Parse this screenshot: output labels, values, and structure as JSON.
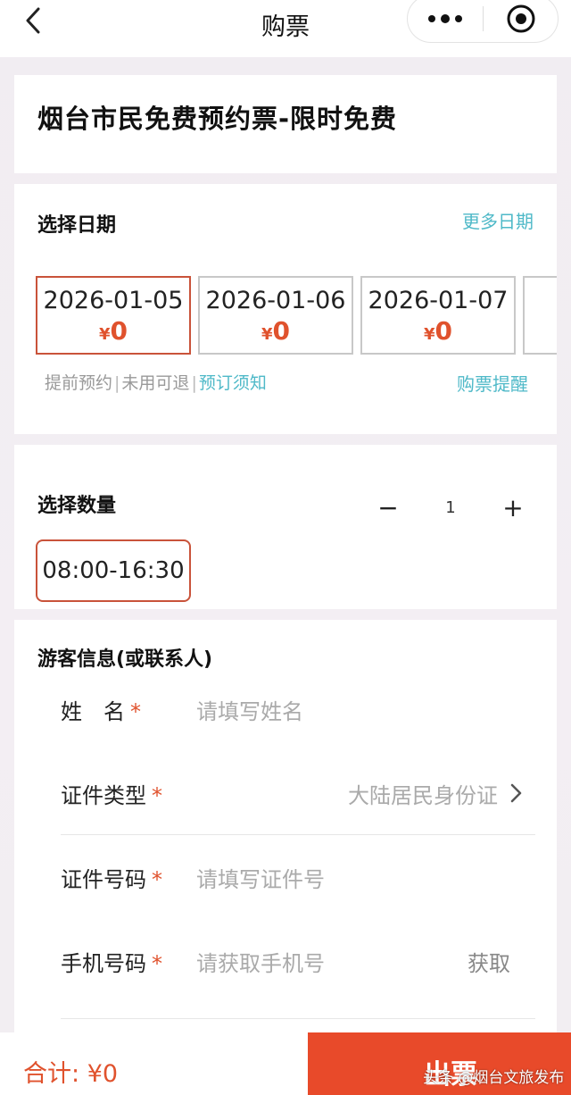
{
  "nav": {
    "title": "购票"
  },
  "ticket": {
    "title": "烟台市民免费预约票-限时免费"
  },
  "date_section": {
    "title": "选择日期",
    "more_label": "更多日期",
    "dates": [
      {
        "date": "2026-01-05",
        "currency": "¥",
        "price": "0",
        "selected": true
      },
      {
        "date": "2026-01-06",
        "currency": "¥",
        "price": "0",
        "selected": false
      },
      {
        "date": "2026-01-07",
        "currency": "¥",
        "price": "0",
        "selected": false
      }
    ],
    "notes": [
      "提前预约",
      "未用可退"
    ],
    "notice_link": "预订须知",
    "reminder_link": "购票提醒"
  },
  "quantity_section": {
    "title": "选择数量",
    "minus": "−",
    "count": "1",
    "plus": "+",
    "time_slot": "08:00-16:30"
  },
  "visitor_section": {
    "title": "游客信息(或联系人)",
    "fields": {
      "name": {
        "label": "姓　名",
        "required": "*",
        "placeholder": "请填写姓名"
      },
      "id_type": {
        "label": "证件类型",
        "required": "*",
        "value": "大陆居民身份证"
      },
      "id_number": {
        "label": "证件号码",
        "required": "*",
        "placeholder": "请填写证件号"
      },
      "phone": {
        "label": "手机号码",
        "required": "*",
        "placeholder": "请获取手机号",
        "action": "获取"
      }
    }
  },
  "footer": {
    "total_label": "合计: ",
    "total_value": "¥0",
    "issue_label": "出票",
    "watermark": "头条 @烟台文旅发布"
  },
  "colors": {
    "accent": "#e0522d",
    "link": "#4fb9c8",
    "button": "#e84a2a"
  }
}
